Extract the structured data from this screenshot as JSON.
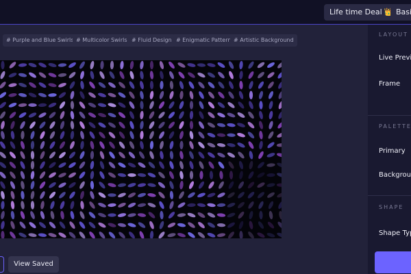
{
  "header": {
    "lifetime_deal_label": "Life time Deal",
    "lifetime_deal_emoji": "👑",
    "basic_label": "Basic"
  },
  "tags": [
    "# Purple and Blue Swirls",
    "# Multicolor Swirls",
    "# Fluid Design",
    "# Enigmatic Pattern",
    "# Artistic Background"
  ],
  "actions": {
    "view_saved_label": "View Saved"
  },
  "panel": {
    "layout_title": "LAYOUT",
    "live_preview_label": "Live Preview",
    "frame_label": "Frame",
    "palette_title": "PALETTE",
    "primary_label": "Primary",
    "background_label": "Background",
    "shape_title": "SHAPE",
    "shape_type_label": "Shape Type"
  },
  "colors": {
    "accent": "#6c63ff",
    "topbar_border": "#4b46c9",
    "canvas_bg": "#04040a",
    "pattern": [
      "#4b3a9e",
      "#6a64d8",
      "#8c6fd6",
      "#b07bd9",
      "#5a4fc4",
      "#a88bd8",
      "#7d3fae"
    ]
  }
}
